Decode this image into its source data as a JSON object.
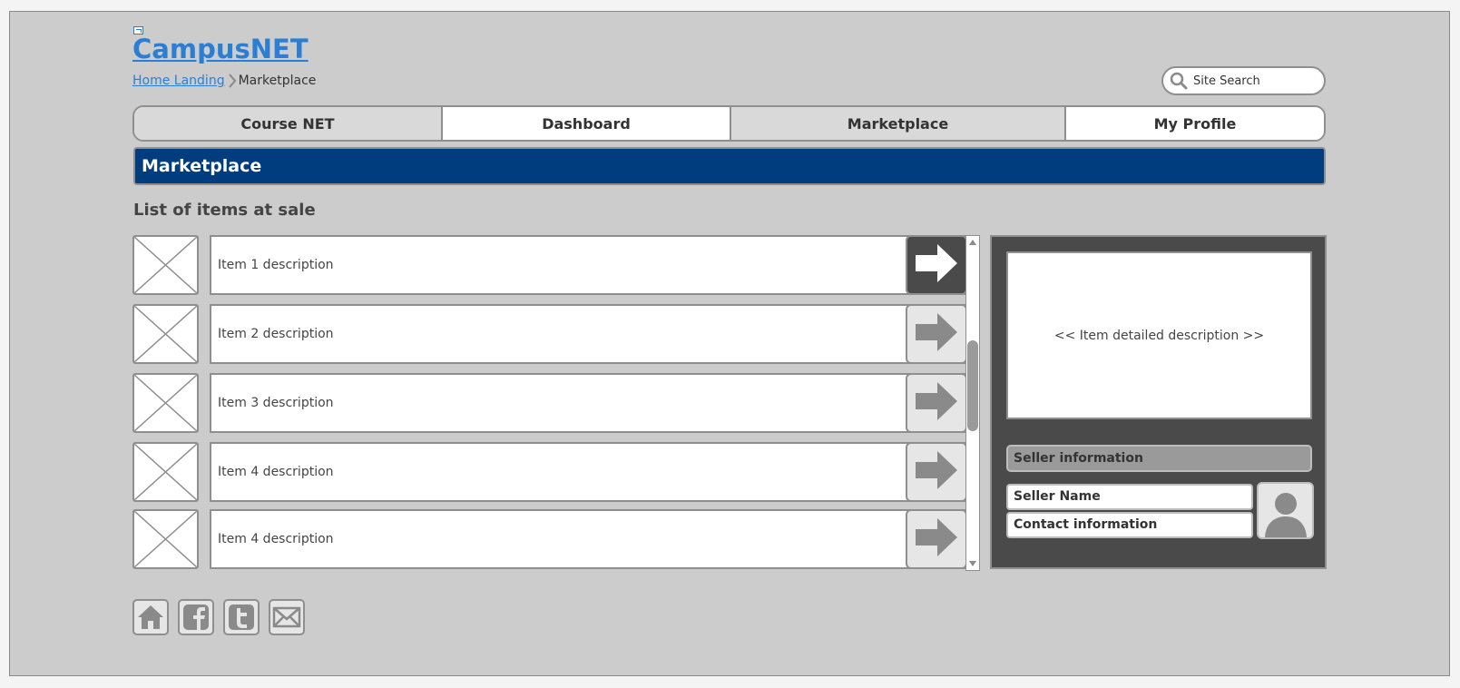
{
  "app": {
    "logo_text": "CampusNET"
  },
  "breadcrumb": {
    "home_label": "Home Landing",
    "current_label": "Marketplace"
  },
  "search": {
    "placeholder": "Site Search"
  },
  "nav": {
    "tabs": [
      {
        "label": "Course NET"
      },
      {
        "label": "Dashboard"
      },
      {
        "label": "Marketplace"
      },
      {
        "label": "My Profile"
      }
    ]
  },
  "header": {
    "title": "Marketplace"
  },
  "list": {
    "title": "List of items at sale",
    "items": [
      {
        "description": "Item 1 description",
        "selected": true
      },
      {
        "description": "Item 2 description",
        "selected": false
      },
      {
        "description": "Item 3 description",
        "selected": false
      },
      {
        "description": "Item 4 description",
        "selected": false
      },
      {
        "description": "Item 4 description",
        "selected": false
      }
    ]
  },
  "detail": {
    "placeholder": "<< Item detailed description >>",
    "seller_header": "Seller information",
    "seller_name": "Seller Name",
    "contact": "Contact information"
  },
  "social": {
    "icons": [
      "home-icon",
      "facebook-icon",
      "twitter-icon",
      "email-icon"
    ]
  },
  "colors": {
    "brand_blue": "#003d7f",
    "link_blue": "#2a7fd4",
    "canvas_grey": "#cccccc",
    "panel_dark": "#4a4a4a"
  }
}
